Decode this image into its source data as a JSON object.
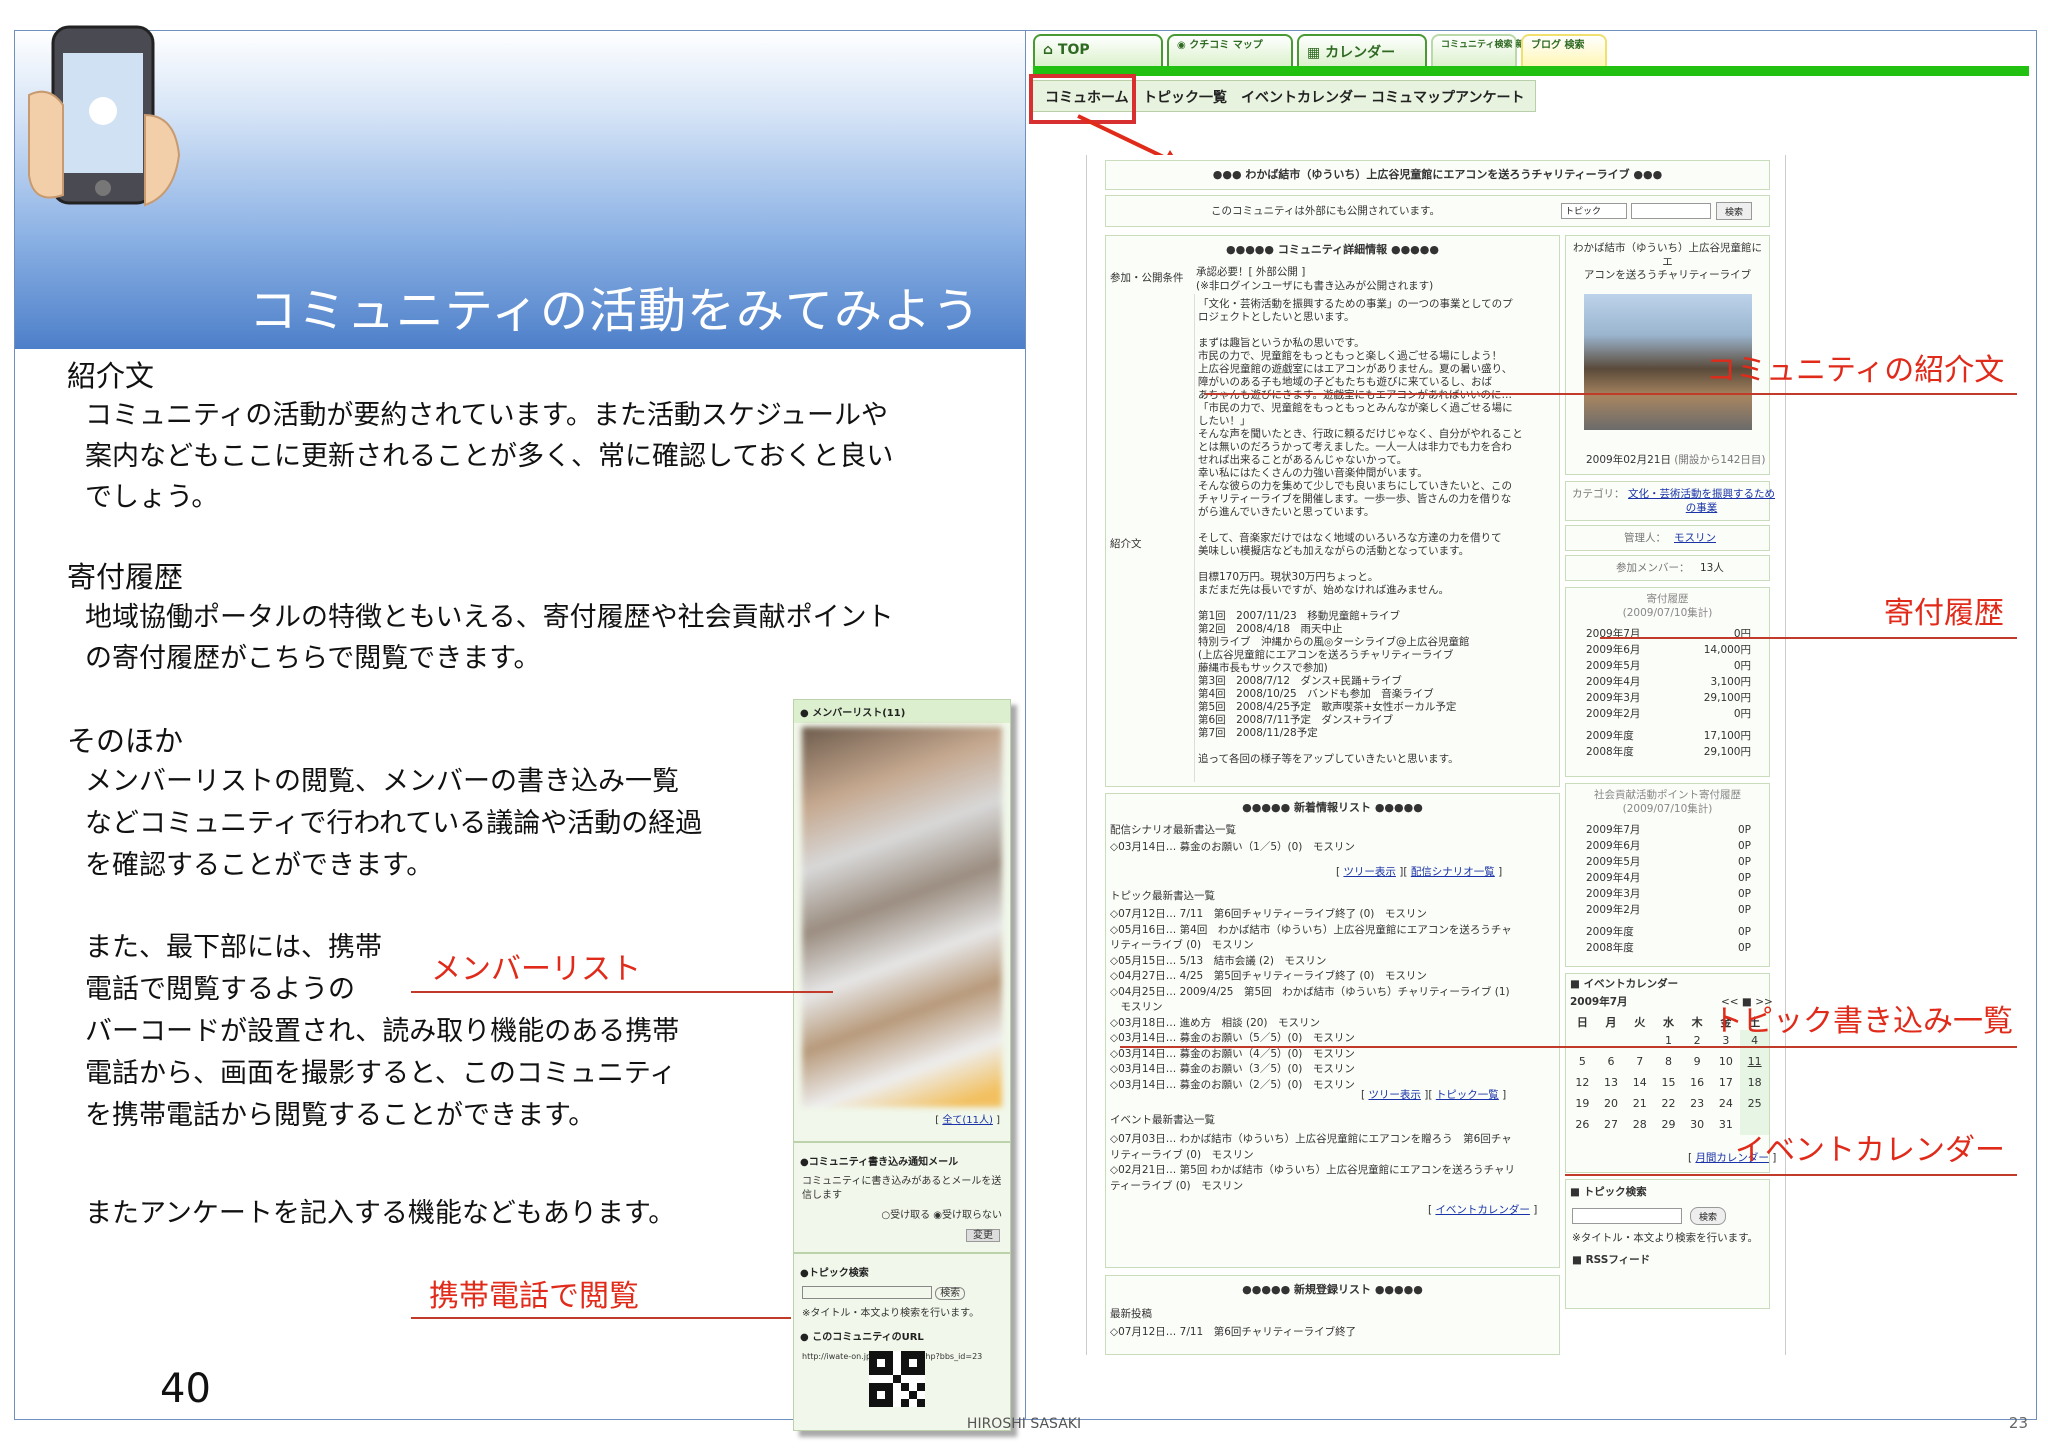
{
  "slide": {
    "title": "コミュニティの活動をみてみよう",
    "sections": [
      {
        "heading": "紹介文",
        "body": [
          "コミュニティの活動が要約されています。また活動スケジュールや",
          "案内などもここに更新されることが多く、常に確認しておくと良い",
          "でしょう。"
        ]
      },
      {
        "heading": "寄付履歴",
        "body": [
          "地域協働ポータルの特徴ともいえる、寄付履歴や社会貢献ポイント",
          "の寄付履歴がこちらで閲覧できます。"
        ]
      },
      {
        "heading": "そのほか",
        "body": [
          "メンバーリストの閲覧、メンバーの書き込み一覧",
          "などコミュニティで行われている議論や活動の経過",
          "を確認することができます。"
        ]
      }
    ],
    "extra_para": [
      "また、最下部には、携帯",
      "電話で閲覧するようの",
      "バーコードが設置され、読み取り機能のある携帯",
      "電話から、画面を撮影すると、このコミュニティ",
      "を携帯電話から閲覧することができます。"
    ],
    "survey_line": "またアンケートを記入する機能などもあります。",
    "page_number": "40",
    "footer_author": "HIROSHI SASAKI",
    "footer_page": "23"
  },
  "callouts": {
    "member_list": "メンバーリスト",
    "mobile": "携帯電話で閲覧",
    "intro": "コミュニティの紹介文",
    "donation": "寄付履歴",
    "topic": "トピック書き込み一覧",
    "event": "イベントカレンダー"
  },
  "side_screenshot": {
    "member_header": "● メンバーリスト(11)",
    "member_all": "全て(11人)",
    "mail_header": "●コミュニティ書き込み通知メール",
    "mail_desc": "コミュニティに書き込みがあるとメールを送信します",
    "mail_opt1": "受け取る",
    "mail_opt2": "受け取らない",
    "mail_btn": "変更",
    "topic_search_header": "●トピック検索",
    "topic_search_btn": "検索",
    "topic_search_note": "※タイトル・本文より検索を行います。",
    "url_header": "● このコミュニティのURL",
    "url_text": "http://iwate-on.jp/community.php?bbs_id=23"
  },
  "tabs": [
    "TOP",
    "クチコミ マップ",
    "カレンダー",
    "コミュニティ検索 新規作成",
    "ブログ 検索"
  ],
  "subnav": [
    "コミュホーム",
    "トピック一覧",
    "イベントカレンダー",
    "コミュマップ",
    "アンケート"
  ],
  "community": {
    "title": "●●● わかば結市（ゆういち）上広谷児童館にエアコンを送ろうチャリティーライブ ●●●",
    "public_note": "このコミュニティは外部にも公開されています。",
    "search_select": "トピック",
    "search_btn": "検索",
    "detail_header": "●●●●● コミュニティ詳細情報 ●●●●●",
    "cond_label": "参加・公開条件",
    "cond_value": [
      "承認必要！[ 外部公開 ]",
      "(※非ログインユーザにも書き込みが公開されます)"
    ],
    "intro_label": "紹介文",
    "intro_lines": [
      "「文化・芸術活動を振興するための事業」の一つの事業としてのプ",
      "ロジェクトとしたいと思います。",
      "",
      "まずは趣旨というか私の思いです。",
      "市民の力で、児童館をもっともっと楽しく過ごせる場にしよう！",
      "上広谷児童館の遊戯室にはエアコンがありません。夏の暑い盛り、",
      "障がいのある子も地域の子どもたちも遊びに来ているし、おば",
      "あちゃんも遊びにきます。遊戯室にもエアコンがあればいいのに…",
      "「市民の力で、児童館をもっともっとみんなが楽しく過ごせる場に",
      "したい！」",
      "そんな声を聞いたとき、行政に頼るだけじゃなく、自分がやれること",
      "とは無いのだろうかって考えました。一人一人は非力でも力を合わ",
      "せれば出来ることがあるんじゃないかって。",
      "幸い私にはたくさんの力強い音楽仲間がいます。",
      "そんな彼らの力を集めて少しでも良いまちにしていきたいと、この",
      "チャリティーライブを開催します。一歩一歩、皆さんの力を借りな",
      "がら進んでいきたいと思っています。",
      "",
      "そして、音楽家だけではなく地域のいろいろな方達の力を借りて",
      "美味しい模擬店なども加えながらの活動となっています。",
      "",
      "目標170万円。現状30万円ちょっと。",
      "まだまだ先は長いですが、始めなければ進みません。",
      "",
      "第1回　2007/11/23　移動児童館+ライブ",
      "第2回　2008/4/18　雨天中止",
      "特別ライブ　沖縄からの風◎ターシライブ@上広谷児童館",
      "(上広谷児童館にエアコンを送ろうチャリティーライブ",
      "藤縄市長もサックスで参加)",
      "第3回　2008/7/12　ダンス+民踊+ライブ",
      "第4回　2008/10/25　バンドも参加　音楽ライブ",
      "第5回　2008/4/25予定　歌声喫茶+女性ボーカル予定",
      "第6回　2008/7/11予定　ダンス+ライブ",
      "第7回　2008/11/28予定",
      "",
      "追って各回の様子等をアップしていきたいと思います。"
    ],
    "side_title": [
      "わかば結市（ゆういち）上広谷児童館にエ",
      "アコンを送ろうチャリティーライブ"
    ],
    "date": "2009年02月21日",
    "date_sub": "(開設から142日目)",
    "category_label": "カテゴリ：",
    "category_value": [
      "文化・芸術活動を振興するため",
      "の事業"
    ],
    "admin_label": "管理人：",
    "admin_value": "モスリン",
    "members_label": "参加メンバー：",
    "members_value": "13人",
    "donation_title": "寄付履歴",
    "donation_sub": "(2009/07/10集計)",
    "donations": [
      [
        "2009年7月",
        "0円"
      ],
      [
        "2009年6月",
        "14,000円"
      ],
      [
        "2009年5月",
        "0円"
      ],
      [
        "2009年4月",
        "3,100円"
      ],
      [
        "2009年3月",
        "29,100円"
      ],
      [
        "2009年2月",
        "0円"
      ]
    ],
    "donation_years": [
      [
        "2009年度",
        "17,100円"
      ],
      [
        "2008年度",
        "29,100円"
      ]
    ],
    "points_title": "社会貢献活動ポイント寄付履歴",
    "points_sub": "(2009/07/10集計)",
    "points": [
      [
        "2009年7月",
        "0P"
      ],
      [
        "2009年6月",
        "0P"
      ],
      [
        "2009年5月",
        "0P"
      ],
      [
        "2009年4月",
        "0P"
      ],
      [
        "2009年3月",
        "0P"
      ],
      [
        "2009年2月",
        "0P"
      ]
    ],
    "points_years": [
      [
        "2009年度",
        "0P"
      ],
      [
        "2008年度",
        "0P"
      ]
    ],
    "news_header": "●●●●● 新着情報リスト ●●●●●",
    "scenario_header": "配信シナリオ最新書込一覧",
    "scenario_items": [
      "◇03月14日… 募金のお願い（1／5）(0)　モスリン"
    ],
    "scenario_links": [
      "ツリー表示",
      "配信シナリオ一覧"
    ],
    "topic_header": "トピック最新書込一覧",
    "topic_items": [
      "◇07月12日… 7/11　第6回チャリティーライブ終了 (0)　モスリン",
      "◇05月16日… 第4回　わかば結市（ゆういち）上広谷児童館にエアコンを送ろうチャ",
      "リティーライブ (0)　モスリン",
      "◇05月15日… 5/13　結市会議 (2)　モスリン",
      "◇04月27日… 4/25　第5回チャリティーライブ終了 (0)　モスリン",
      "◇04月25日… 2009/4/25　第5回　わかば結市（ゆういち）チャリティーライブ (1)",
      "　モスリン",
      "◇03月18日… 進め方　相談 (20)　モスリン",
      "◇03月14日… 募金のお願い（5／5）(0)　モスリン",
      "◇03月14日… 募金のお願い（4／5）(0)　モスリン",
      "◇03月14日… 募金のお願い（3／5）(0)　モスリン",
      "◇03月14日… 募金のお願い（2／5）(0)　モスリン"
    ],
    "topic_links": [
      "ツリー表示",
      "トピック一覧"
    ],
    "event_header": "イベント最新書込一覧",
    "event_items": [
      "◇07月03日… わかば結市（ゆういち）上広谷児童館にエアコンを贈ろう　第6回チャ",
      "リティーライブ (0)　モスリン",
      "◇02月21日… 第5回 わかば結市（ゆういち）上広谷児童館にエアコンを送ろうチャリ",
      "ティーライブ (0)　モスリン"
    ],
    "event_link": "イベントカレンダー",
    "newreg_header": "●●●●● 新規登録リスト ●●●●●",
    "newpost_label": "最新投稿",
    "newpost_item": "◇07月12日… 7/11　第6回チャリティーライブ終了",
    "calendar_header": "■ イベントカレンダー",
    "calendar_month": "2009年7月",
    "calendar_nav": "<< ■ >>",
    "calendar_days": [
      "日",
      "月",
      "火",
      "水",
      "木",
      "金",
      "土"
    ],
    "calendar_rows": [
      [
        "",
        "",
        "",
        "1",
        "2",
        "3",
        "4"
      ],
      [
        "5",
        "6",
        "7",
        "8",
        "9",
        "10",
        "11"
      ],
      [
        "12",
        "13",
        "14",
        "15",
        "16",
        "17",
        "18"
      ],
      [
        "19",
        "20",
        "21",
        "22",
        "23",
        "24",
        "25"
      ],
      [
        "26",
        "27",
        "28",
        "29",
        "30",
        "31",
        ""
      ]
    ],
    "calendar_link": "月間カレンダー",
    "topicsearch_header": "■ トピック検索",
    "topicsearch_btn": "検索",
    "topicsearch_note": "※タイトル・本文より検索を行います。",
    "rss_header": "■ RSSフィード"
  }
}
